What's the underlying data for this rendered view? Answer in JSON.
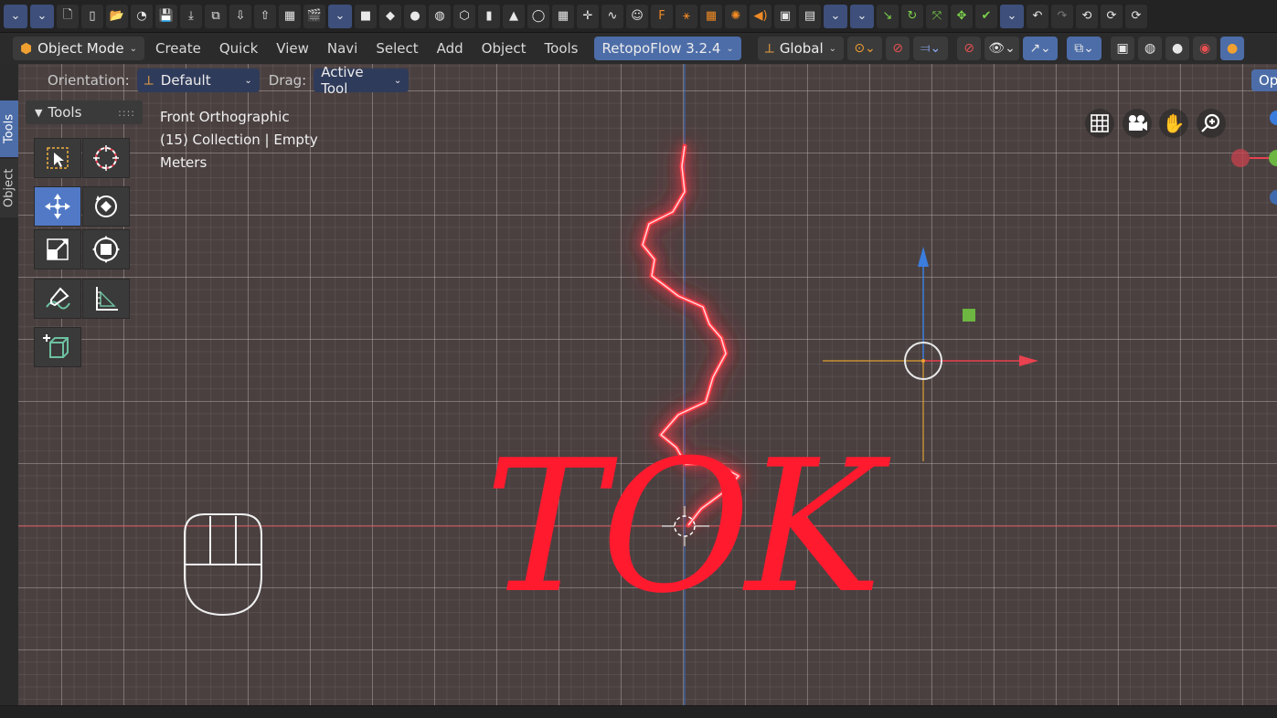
{
  "header": {
    "mode_label": "Object Mode",
    "menus": [
      "Create",
      "Quick",
      "View",
      "Navi",
      "Select",
      "Add",
      "Object",
      "Tools"
    ],
    "addon_label": "RetopoFlow 3.2.4",
    "transform_label": "Global"
  },
  "tool_settings": {
    "orientation_label": "Orientation:",
    "orientation_value": "Default",
    "drag_label": "Drag:",
    "drag_value": "Active Tool",
    "options_label": "Op"
  },
  "sidebar_tabs": [
    "Tools",
    "Object"
  ],
  "tools_panel": {
    "title": "Tools"
  },
  "viewport_info": {
    "view_name": "Front Orthographic",
    "collection": "(15) Collection | Empty",
    "units": "Meters"
  },
  "scene_text": "TOK",
  "colors": {
    "accent": "#5179c6",
    "text_object": "#ff1a2e",
    "x_axis": "#e8414f",
    "z_axis": "#3b7ddd",
    "y_axis": "#6cb641"
  },
  "icons": [
    "file-new-icon",
    "file-open-icon",
    "save-icon",
    "undo-icon",
    "redo-icon",
    "grid-icon",
    "camera-icon",
    "hand-icon",
    "zoom-icon",
    "cursor-icon",
    "move-icon",
    "rotate-icon",
    "scale-icon",
    "transform-icon",
    "annotate-icon",
    "measure-icon",
    "add-cube-icon"
  ]
}
